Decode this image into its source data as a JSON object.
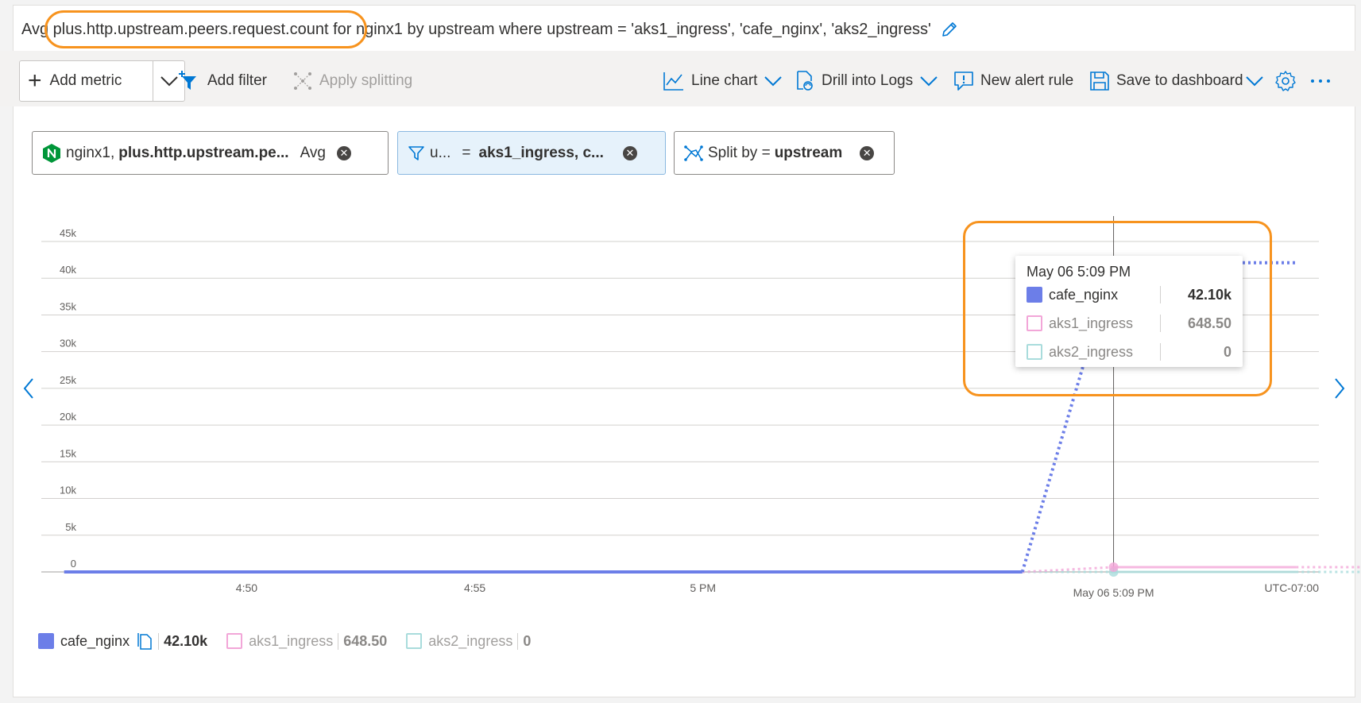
{
  "title": {
    "text": "Avg plus.http.upstream.peers.request.count for nginx1 by upstream where upstream = 'aks1_ingress', 'cafe_nginx', 'aks2_ingress'"
  },
  "toolbar": {
    "add_metric": "Add metric",
    "add_filter": "Add filter",
    "apply_splitting": "Apply splitting",
    "line_chart": "Line chart",
    "drill_into_logs": "Drill into Logs",
    "new_alert_rule": "New alert rule",
    "save_to_dashboard": "Save to dashboard"
  },
  "pills": {
    "metric": {
      "resource": "nginx1,",
      "metric": "plus.http.upstream.pe...",
      "agg": "Avg"
    },
    "filter": {
      "prop": "u...",
      "op": "=",
      "values": "aks1_ingress, c..."
    },
    "split": {
      "label": "Split by =",
      "value": "upstream"
    }
  },
  "colors": {
    "cafe_nginx": "#6c7ee8",
    "aks1_ingress": "#f2a6d8",
    "aks2_ingress": "#a9dcdc",
    "highlight": "#f7931e",
    "accent": "#0078d4"
  },
  "tooltip": {
    "title": "May 06 5:09 PM",
    "rows": [
      {
        "name": "cafe_nginx",
        "value": "42.10k"
      },
      {
        "name": "aks1_ingress",
        "value": "648.50"
      },
      {
        "name": "aks2_ingress",
        "value": "0"
      }
    ]
  },
  "legend": [
    {
      "name": "cafe_nginx",
      "value": "42.10k"
    },
    {
      "name": "aks1_ingress",
      "value": "648.50"
    },
    {
      "name": "aks2_ingress",
      "value": "0"
    }
  ],
  "chart_data": {
    "type": "line",
    "y_ticks": [
      "0",
      "5k",
      "10k",
      "15k",
      "20k",
      "25k",
      "30k",
      "35k",
      "40k",
      "45k"
    ],
    "ylim": [
      0,
      45000
    ],
    "x_ticks": [
      "4:50",
      "4:55",
      "5 PM"
    ],
    "cursor_label": "May 06 5:09 PM",
    "timezone": "UTC-07:00",
    "xlim_minutes": [
      -14.5,
      13.5
    ],
    "grid": true,
    "series": [
      {
        "name": "cafe_nginx",
        "solid": [
          [
            -14,
            0
          ],
          [
            7,
            0
          ]
        ],
        "dotted": [
          [
            7,
            0
          ],
          [
            9,
            42100
          ]
        ],
        "solid2": [
          [
            9,
            42100
          ],
          [
            10,
            42100
          ]
        ],
        "dotted2": [
          [
            10,
            42100
          ],
          [
            13,
            42100
          ]
        ]
      },
      {
        "name": "aks1_ingress",
        "solid": [
          [
            -14,
            0
          ],
          [
            7,
            0
          ]
        ],
        "dotted": [
          [
            7,
            0
          ],
          [
            9,
            648.5
          ]
        ],
        "solid2": [
          [
            9,
            648.5
          ],
          [
            13,
            648.5
          ]
        ],
        "dotted2": [
          [
            13,
            648.5
          ],
          [
            16,
            648.5
          ]
        ]
      },
      {
        "name": "aks2_ingress",
        "solid": [
          [
            -14,
            0
          ],
          [
            7,
            0
          ]
        ],
        "dotted": [
          [
            7,
            0
          ],
          [
            9,
            0
          ]
        ],
        "solid2": [
          [
            9,
            0
          ],
          [
            13,
            0
          ]
        ],
        "dotted2": [
          [
            13,
            0
          ],
          [
            16,
            0
          ]
        ]
      }
    ],
    "cursor_x": 9
  }
}
